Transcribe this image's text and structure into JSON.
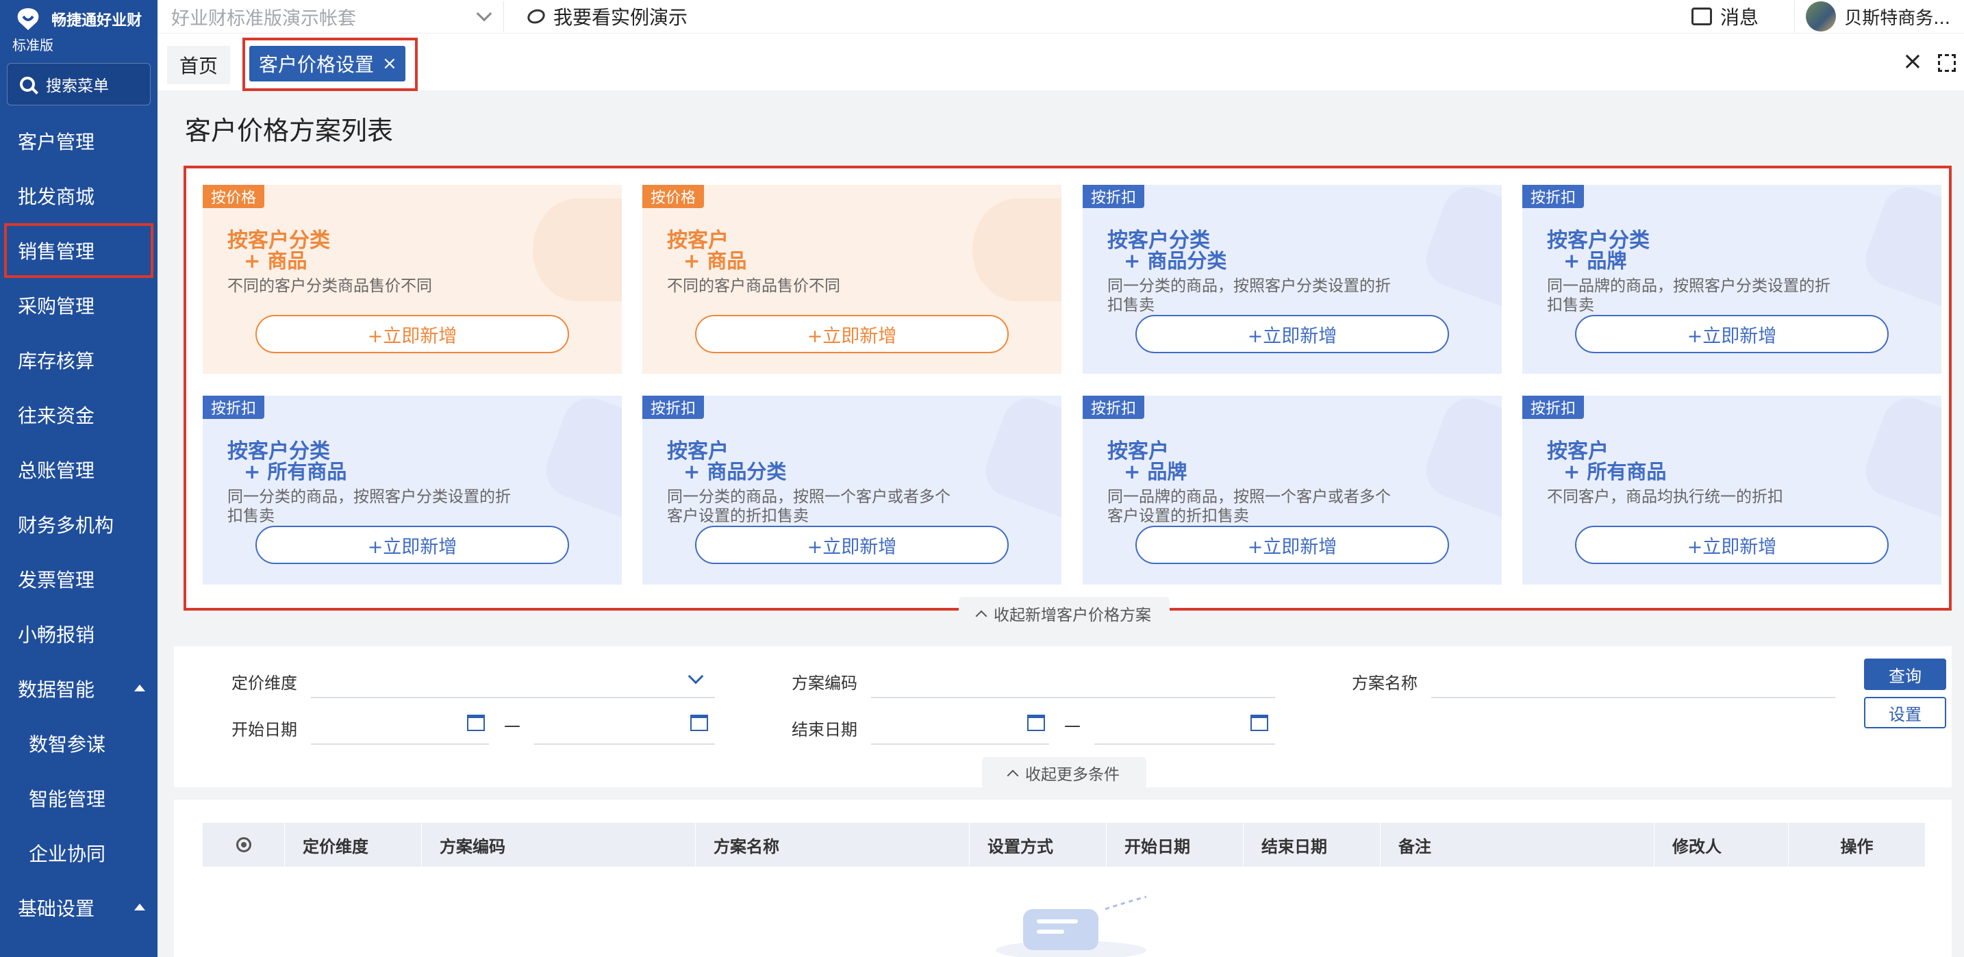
{
  "app": {
    "brand": "畅捷通好业财",
    "edition": "标准版",
    "search_menu": "搜索菜单"
  },
  "topbar": {
    "account_book": "好业财标准版演示帐套",
    "demo_link": "我要看实例演示",
    "messages": "消息",
    "user": "贝斯特商务..."
  },
  "sidebar": {
    "items": [
      {
        "label": "客户管理"
      },
      {
        "label": "批发商城"
      },
      {
        "label": "销售管理"
      },
      {
        "label": "采购管理"
      },
      {
        "label": "库存核算"
      },
      {
        "label": "往来资金"
      },
      {
        "label": "总账管理"
      },
      {
        "label": "财务多机构"
      },
      {
        "label": "发票管理"
      },
      {
        "label": "小畅报销"
      },
      {
        "label": "数据智能"
      },
      {
        "label": "数智参谋"
      },
      {
        "label": "智能管理"
      },
      {
        "label": "企业协同"
      },
      {
        "label": "基础设置"
      }
    ]
  },
  "tabs": {
    "home": "首页",
    "active": "客户价格设置",
    "close_glyph": "×"
  },
  "page": {
    "title": "客户价格方案列表",
    "collapse_new": "收起新增客户价格方案",
    "collapse_more": "收起更多条件"
  },
  "cards": [
    {
      "tag": "按价格",
      "line1": "按客户分类",
      "line2": "+  商品",
      "desc": "不同的客户分类商品售价不同",
      "button": "+立即新增"
    },
    {
      "tag": "按价格",
      "line1": "按客户",
      "line2": "+  商品",
      "desc": "不同的客户商品售价不同",
      "button": "+立即新增"
    },
    {
      "tag": "按折扣",
      "line1": "按客户分类",
      "line2": "+  商品分类",
      "desc": "同一分类的商品，按照客户分类设置的折扣售卖",
      "button": "+立即新增"
    },
    {
      "tag": "按折扣",
      "line1": "按客户分类",
      "line2": "+  品牌",
      "desc": "同一品牌的商品，按照客户分类设置的折扣售卖",
      "button": "+立即新增"
    },
    {
      "tag": "按折扣",
      "line1": "按客户分类",
      "line2": "+  所有商品",
      "desc": "同一分类的商品，按照客户分类设置的折扣售卖",
      "button": "+立即新增"
    },
    {
      "tag": "按折扣",
      "line1": "按客户",
      "line2": "+  商品分类",
      "desc": "同一分类的商品，按照一个客户或者多个客户设置的折扣售卖",
      "button": "+立即新增"
    },
    {
      "tag": "按折扣",
      "line1": "按客户",
      "line2": "+  品牌",
      "desc": "同一品牌的商品，按照一个客户或者多个客户设置的折扣售卖",
      "button": "+立即新增"
    },
    {
      "tag": "按折扣",
      "line1": "按客户",
      "line2": "+  所有商品",
      "desc": "不同客户，商品均执行统一的折扣",
      "button": "+立即新增"
    }
  ],
  "filters": {
    "pricing_dimension": "定价维度",
    "scheme_code": "方案编码",
    "scheme_name": "方案名称",
    "start_date": "开始日期",
    "end_date": "结束日期",
    "range_sep": "—",
    "query": "查询",
    "reset": "设置"
  },
  "table": {
    "columns": [
      "定价维度",
      "方案编码",
      "方案名称",
      "设置方式",
      "开始日期",
      "结束日期",
      "备注",
      "修改人",
      "操作"
    ]
  },
  "colors": {
    "sidebar": "#1f4e9b",
    "primary": "#2d5fb0",
    "orange": "#f0873a",
    "highlight_border": "#d9392b"
  }
}
